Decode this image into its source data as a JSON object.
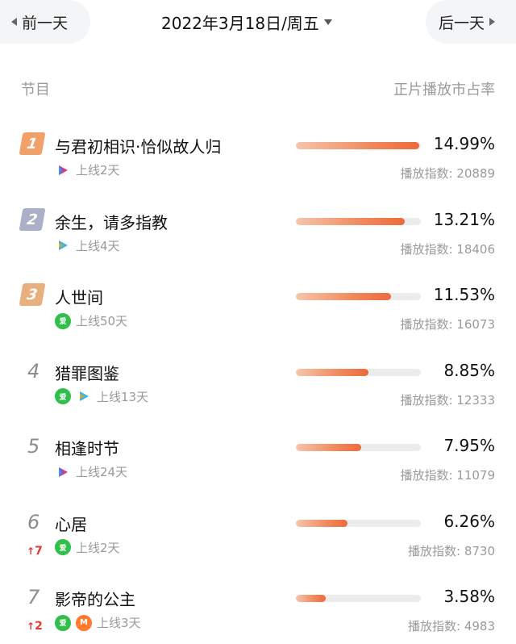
{
  "header": {
    "prev_label": "前一天",
    "next_label": "后一天",
    "date_label": "2022年3月18日/周五"
  },
  "columns": {
    "left": "节目",
    "right": "正片播放市占率"
  },
  "items": [
    {
      "rank": "1",
      "title": "与君初相识·恰似故人归",
      "platforms": [
        "youku"
      ],
      "online": "上线2天",
      "share": "14.99%",
      "share_value": 14.99,
      "index_label": "播放指数: 20889",
      "trend": "",
      "badge_color": "#f2a06a"
    },
    {
      "rank": "2",
      "title": "余生，请多指教",
      "platforms": [
        "tencent"
      ],
      "online": "上线4天",
      "share": "13.21%",
      "share_value": 13.21,
      "index_label": "播放指数: 18406",
      "trend": "",
      "badge_color": "#a9b0c8"
    },
    {
      "rank": "3",
      "title": "人世间",
      "platforms": [
        "iqiyi"
      ],
      "online": "上线50天",
      "share": "11.53%",
      "share_value": 11.53,
      "index_label": "播放指数: 16073",
      "trend": "",
      "badge_color": "#e9b07f"
    },
    {
      "rank": "4",
      "title": "猎罪图鉴",
      "platforms": [
        "iqiyi",
        "tencent"
      ],
      "online": "上线13天",
      "share": "8.85%",
      "share_value": 8.85,
      "index_label": "播放指数: 12333",
      "trend": ""
    },
    {
      "rank": "5",
      "title": "相逢时节",
      "platforms": [
        "youku"
      ],
      "online": "上线24天",
      "share": "7.95%",
      "share_value": 7.95,
      "index_label": "播放指数: 11079",
      "trend": ""
    },
    {
      "rank": "6",
      "title": "心居",
      "platforms": [
        "iqiyi"
      ],
      "online": "上线2天",
      "share": "6.26%",
      "share_value": 6.26,
      "index_label": "播放指数: 8730",
      "trend": "7"
    },
    {
      "rank": "7",
      "title": "影帝的公主",
      "platforms": [
        "iqiyi",
        "mango"
      ],
      "online": "上线3天",
      "share": "3.58%",
      "share_value": 3.58,
      "index_label": "播放指数: 4983",
      "trend": "2"
    }
  ],
  "platform_icons": {
    "youku": {
      "name": "youku-icon",
      "text": ""
    },
    "tencent": {
      "name": "tencent-video-icon",
      "text": ""
    },
    "iqiyi": {
      "name": "iqiyi-icon",
      "text": "爱"
    },
    "mango": {
      "name": "mango-tv-icon",
      "text": "M"
    }
  },
  "colors": {
    "accent": "#ed6a3b",
    "trend_up": "#e53935",
    "muted": "#9a9a9a"
  }
}
